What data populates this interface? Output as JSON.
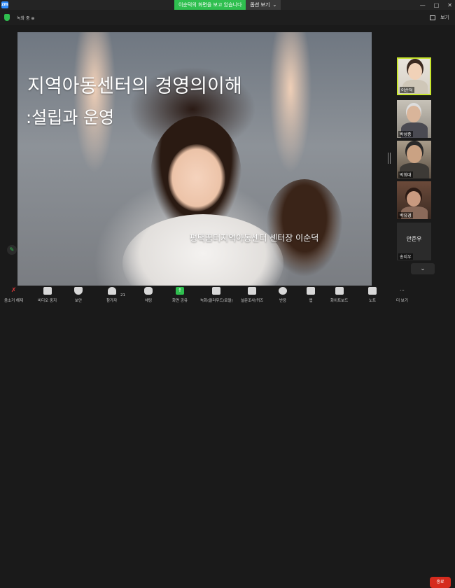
{
  "topbar": {
    "app_logo": "zm",
    "share_banner": "이순덕의 화면을 보고 있습니다",
    "view_options": "옵션 보기",
    "view_options_chevron": "⌄",
    "win_minimize": "—",
    "win_maximize": "□",
    "win_close": "✕"
  },
  "inforow": {
    "info_text": "녹화 중 ⊕",
    "view_label": "보기"
  },
  "slide": {
    "title_line1": "지역아동센터의 경영의이해",
    "title_line2": ":설립과 운영",
    "presenter": "평택꿈터지역아동센터 센터장 이순덕"
  },
  "participants": [
    {
      "name": "이순덕"
    },
    {
      "name": "박성종"
    },
    {
      "name": "박희대"
    },
    {
      "name": "박유경"
    },
    {
      "name": "송지우",
      "center_text": "안준우"
    }
  ],
  "toolbar": {
    "items": [
      {
        "label": "음소거 해제",
        "icon": "mic-off-icon"
      },
      {
        "label": "비디오 중지",
        "icon": "video-icon"
      },
      {
        "label": "보안",
        "icon": "shield-icon"
      },
      {
        "label": "참가자",
        "icon": "participants-icon",
        "badge": "21"
      },
      {
        "label": "채팅",
        "icon": "chat-icon"
      },
      {
        "label": "화면 공유",
        "icon": "share-screen-icon"
      },
      {
        "label": "녹화(클라우드/로컬)",
        "icon": "record-icon"
      },
      {
        "label": "설문조사/퀴즈",
        "icon": "poll-icon"
      },
      {
        "label": "반응",
        "icon": "reaction-icon"
      },
      {
        "label": "앱",
        "icon": "apps-icon"
      },
      {
        "label": "화이트보드",
        "icon": "whiteboard-icon"
      },
      {
        "label": "노트",
        "icon": "notes-icon"
      },
      {
        "label": "더 보기",
        "icon": "more-icon"
      }
    ],
    "end_label": "종료"
  },
  "colors": {
    "accent_green": "#2fbf4f",
    "end_red": "#d52b1e",
    "active_speaker": "#c8e62e"
  }
}
